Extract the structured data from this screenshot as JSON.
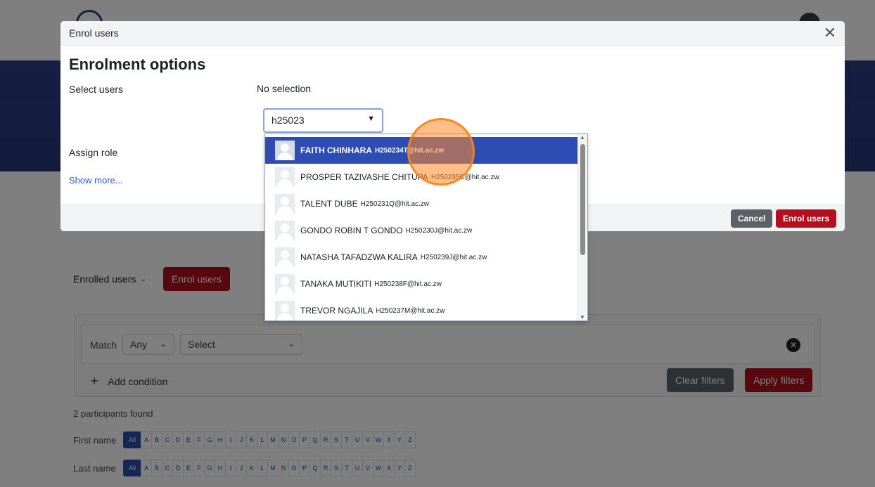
{
  "page": {
    "enrolled_users_label": "Enrolled users",
    "enrol_users_button": "Enrol users",
    "filter": {
      "match_label": "Match",
      "match_value": "Any",
      "select_value": "Select",
      "add_condition": "Add condition",
      "clear_filters": "Clear filters",
      "apply_filters": "Apply filters"
    },
    "participants_found": "2 participants found",
    "first_name_label": "First name",
    "last_name_label": "Last name",
    "all_label": "All",
    "letters": [
      "A",
      "B",
      "C",
      "D",
      "E",
      "F",
      "G",
      "H",
      "I",
      "J",
      "K",
      "L",
      "M",
      "N",
      "O",
      "P",
      "Q",
      "R",
      "S",
      "T",
      "U",
      "V",
      "W",
      "X",
      "Y",
      "Z"
    ]
  },
  "modal": {
    "title": "Enrol users",
    "close_glyph": "✕",
    "section_heading": "Enrolment options",
    "select_users_label": "Select users",
    "no_selection": "No selection",
    "search_value": "h25023",
    "assign_role_label": "Assign role",
    "show_more": "Show more...",
    "cancel_button": "Cancel",
    "enrol_button": "Enrol users"
  },
  "dropdown": {
    "items": [
      {
        "name": "FAITH CHINHARA",
        "email": "H250234T@hit.ac.zw",
        "selected": true
      },
      {
        "name": "PROSPER TAZIVASHE CHITUPA",
        "email": "H250235C@hit.ac.zw",
        "selected": false
      },
      {
        "name": "TALENT DUBE",
        "email": "H250231Q@hit.ac.zw",
        "selected": false
      },
      {
        "name": "GONDO ROBIN T GONDO",
        "email": "H250230J@hit.ac.zw",
        "selected": false
      },
      {
        "name": "NATASHA TAFADZWA KALIRA",
        "email": "H250239J@hit.ac.zw",
        "selected": false
      },
      {
        "name": "TANAKA MUTIKITI",
        "email": "H250238F@hit.ac.zw",
        "selected": false
      },
      {
        "name": "TREVOR NGAJILA",
        "email": "H250237M@hit.ac.zw",
        "selected": false
      }
    ]
  },
  "colors": {
    "brand_blue": "#2c3e86",
    "selection_blue": "#2d4cb4",
    "primary_red": "#b30f1f",
    "secondary_grey": "#5a6268",
    "click_highlight": "#ff8a28"
  }
}
